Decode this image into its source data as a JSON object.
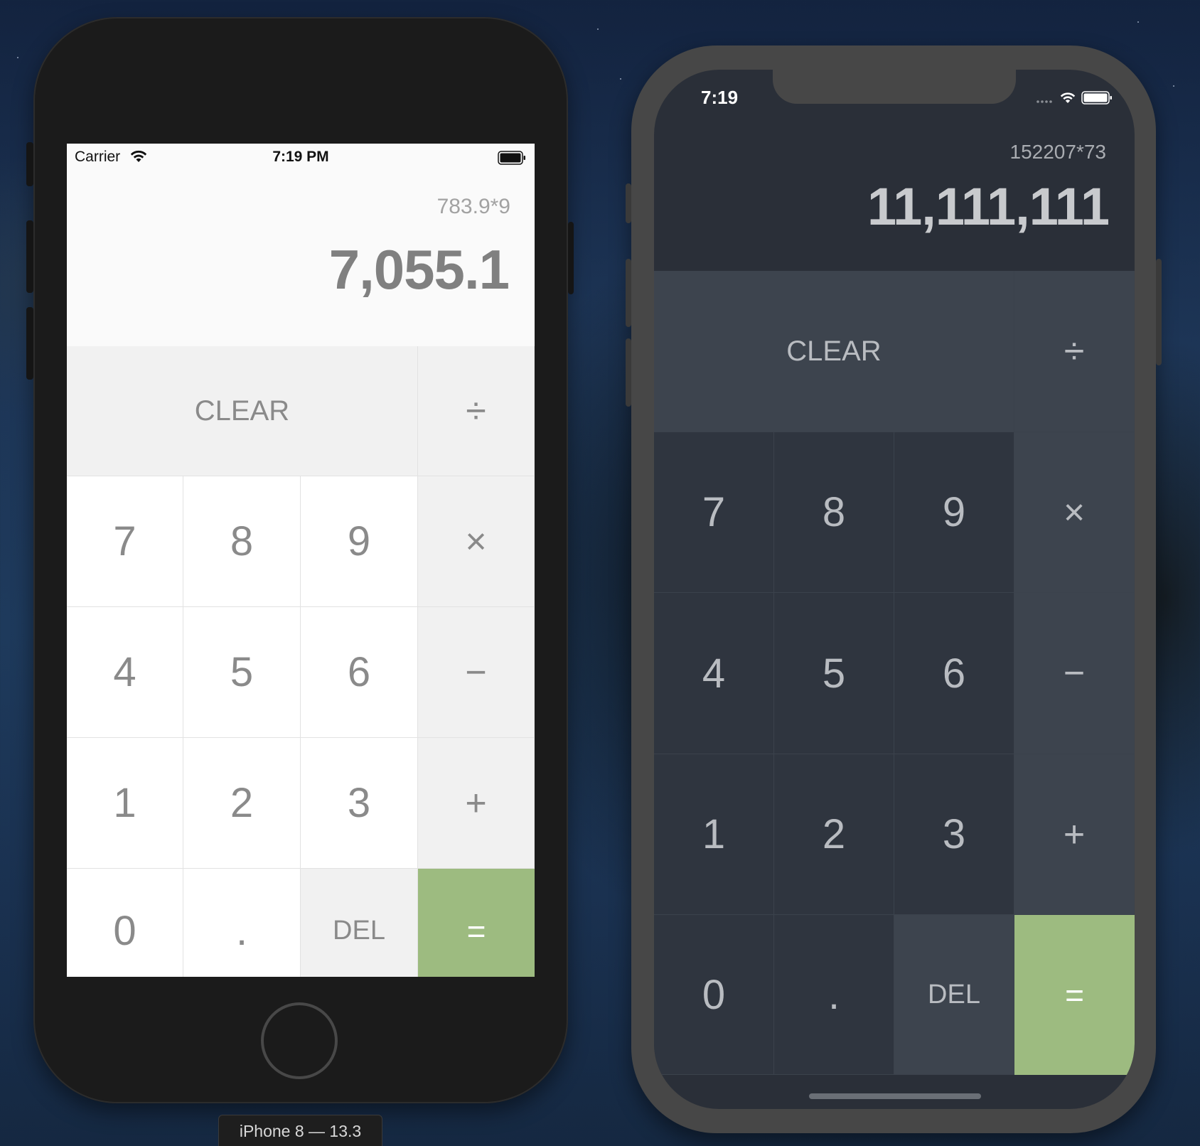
{
  "left_device": {
    "status": {
      "carrier": "Carrier",
      "time": "7:19 PM"
    },
    "display": {
      "expression": "783.9*9",
      "result": "7,055.1"
    },
    "label": "iPhone 8 — 13.3"
  },
  "right_device": {
    "status": {
      "time": "7:19"
    },
    "display": {
      "expression": "152207*73",
      "result": "11,111,111"
    }
  },
  "keys": {
    "clear": "CLEAR",
    "divide": "÷",
    "multiply": "×",
    "subtract": "−",
    "add": "+",
    "equals": "=",
    "del": "DEL",
    "decimal": ".",
    "d0": "0",
    "d1": "1",
    "d2": "2",
    "d3": "3",
    "d4": "4",
    "d5": "5",
    "d6": "6",
    "d7": "7",
    "d8": "8",
    "d9": "9"
  },
  "colors": {
    "accent_equals": "#9dbb80",
    "light_bg": "#fafafa",
    "dark_bg": "#2a2f38"
  }
}
